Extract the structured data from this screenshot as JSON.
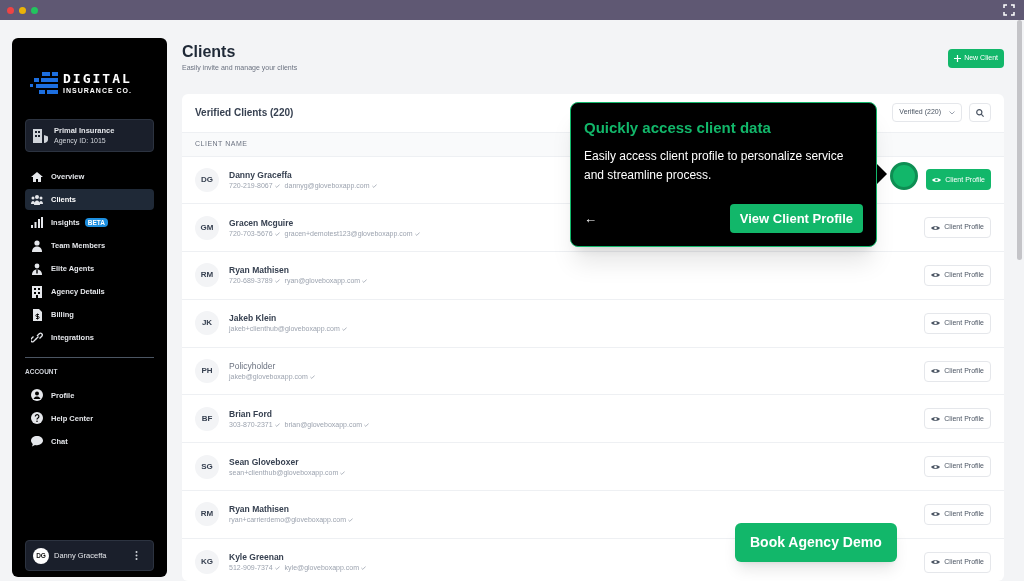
{
  "logo": {
    "name": "DIGITAL",
    "tagline": "INSURANCE CO."
  },
  "agency": {
    "name": "Primal Insurance",
    "id": "Agency ID: 1015"
  },
  "nav": [
    {
      "label": "Overview",
      "kind": "home",
      "selected": false
    },
    {
      "label": "Clients",
      "kind": "users",
      "selected": true
    },
    {
      "label": "Insights",
      "kind": "bars",
      "selected": false,
      "badge": "BETA"
    },
    {
      "label": "Team Members",
      "kind": "person",
      "selected": false
    },
    {
      "label": "Elite Agents",
      "kind": "agent",
      "selected": false
    },
    {
      "label": "Agency Details",
      "kind": "building",
      "selected": false
    },
    {
      "label": "Billing",
      "kind": "bill",
      "selected": false
    },
    {
      "label": "Integrations",
      "kind": "link",
      "selected": false
    }
  ],
  "account_heading": "ACCOUNT",
  "account_nav": [
    {
      "label": "Profile",
      "kind": "profile",
      "selected": false
    },
    {
      "label": "Help Center",
      "kind": "help",
      "selected": false
    },
    {
      "label": "Chat",
      "kind": "chat",
      "selected": false
    }
  ],
  "user": {
    "initials": "DG",
    "name": "Danny Graceffa"
  },
  "page": {
    "title": "Clients",
    "subtitle": "Easily invite and manage your clients",
    "new_button": "New Client"
  },
  "card": {
    "title": "Verified Clients (220)",
    "filter": "Verified (220)",
    "column": "CLIENT NAME"
  },
  "rows": [
    {
      "initials": "DG",
      "name": "Danny Graceffa",
      "muted": false,
      "highlighted": true,
      "button": "Client Profile",
      "contacts": [
        {
          "text": "720-219-8067",
          "verified": true
        },
        {
          "text": "dannyg@gloveboxapp.com",
          "verified": true
        }
      ]
    },
    {
      "initials": "GM",
      "name": "Gracen Mcguire",
      "muted": false,
      "highlighted": false,
      "button": "Client Profile",
      "contacts": [
        {
          "text": "720-703-5676",
          "verified": true
        },
        {
          "text": "gracen+demotest123@gloveboxapp.com",
          "verified": true
        }
      ]
    },
    {
      "initials": "RM",
      "name": "Ryan Mathisen",
      "muted": false,
      "highlighted": false,
      "button": "Client Profile",
      "contacts": [
        {
          "text": "720-689-3789",
          "verified": true
        },
        {
          "text": "ryan@gloveboxapp.com",
          "verified": true
        }
      ]
    },
    {
      "initials": "JK",
      "name": "Jakeb Klein",
      "muted": false,
      "highlighted": false,
      "button": "Client Profile",
      "contacts": [
        {
          "text": "jakeb+clienthub@gloveboxapp.com",
          "verified": true
        }
      ]
    },
    {
      "initials": "PH",
      "name": "Policyholder",
      "muted": true,
      "highlighted": false,
      "button": "Client Profile",
      "contacts": [
        {
          "text": "jakeb@gloveboxapp.com",
          "verified": true
        }
      ]
    },
    {
      "initials": "BF",
      "name": "Brian Ford",
      "muted": false,
      "highlighted": false,
      "button": "Client Profile",
      "contacts": [
        {
          "text": "303-870-2371",
          "verified": true
        },
        {
          "text": "brian@gloveboxapp.com",
          "verified": true
        }
      ]
    },
    {
      "initials": "SG",
      "name": "Sean Gloveboxer",
      "muted": false,
      "highlighted": false,
      "button": "Client Profile",
      "contacts": [
        {
          "text": "sean+clienthub@gloveboxapp.com",
          "verified": true
        }
      ]
    },
    {
      "initials": "RM",
      "name": "Ryan Mathisen",
      "muted": false,
      "highlighted": false,
      "button": "Client Profile",
      "contacts": [
        {
          "text": "ryan+carrierdemo@gloveboxapp.com",
          "verified": true
        }
      ]
    },
    {
      "initials": "KG",
      "name": "Kyle Greenan",
      "muted": false,
      "highlighted": false,
      "button": "Client Profile",
      "contacts": [
        {
          "text": "512-909-7374",
          "verified": true
        },
        {
          "text": "kyle@gloveboxapp.com",
          "verified": true
        }
      ]
    }
  ],
  "tooltip": {
    "title": "Quickly access client data",
    "body": "Easily access client profile to personalize service and streamline process.",
    "back": "←",
    "action": "View Client Profile"
  },
  "demo_button": "Book Agency Demo"
}
